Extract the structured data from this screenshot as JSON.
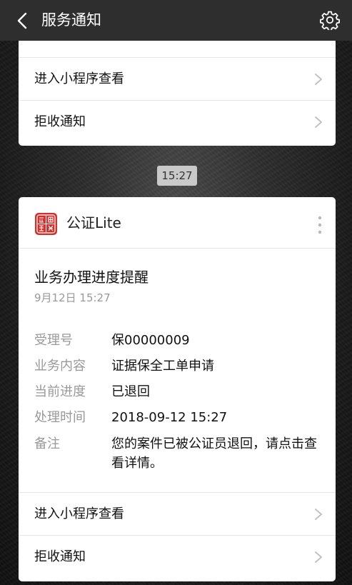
{
  "nav": {
    "title": "服务通知"
  },
  "top_card": {
    "rows": [
      {
        "label": "进入小程序查看"
      },
      {
        "label": "拒收通知"
      }
    ]
  },
  "timestamp": "15:27",
  "main_card": {
    "app_name": "公证Lite",
    "notice_title": "业务办理进度提醒",
    "notice_date": "9月12日  15:27",
    "fields": [
      {
        "key": "受理号",
        "value": "保00000009"
      },
      {
        "key": "业务内容",
        "value": "证据保全工单申请"
      },
      {
        "key": "当前进度",
        "value": "已退回"
      },
      {
        "key": "处理时间",
        "value": "2018-09-12 15:27"
      },
      {
        "key": "备注",
        "value": "您的案件已被公证员退回，请点击查看详情。"
      }
    ],
    "rows": [
      {
        "label": "进入小程序查看"
      },
      {
        "label": "拒收通知"
      }
    ]
  },
  "icons": {
    "back": "chevron-left-icon",
    "settings": "gear-icon",
    "more": "more-vertical-icon",
    "row": "chevron-right-icon",
    "logo": "notary-seal-logo"
  },
  "colors": {
    "navbar": "#2e2e2e",
    "logo_red": "#d0312d",
    "secondary_text": "#999999"
  }
}
